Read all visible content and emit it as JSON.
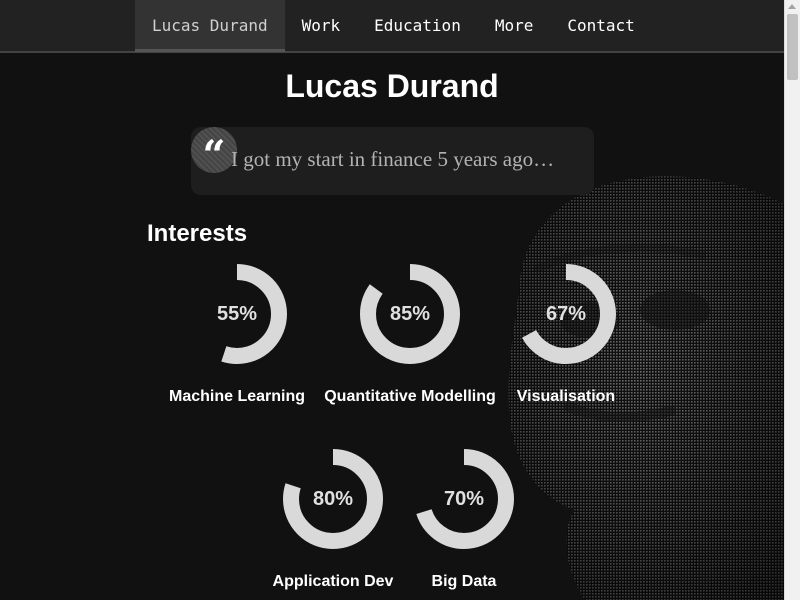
{
  "nav": {
    "items": [
      {
        "label": "Lucas Durand",
        "active": true
      },
      {
        "label": "Work",
        "active": false
      },
      {
        "label": "Education",
        "active": false
      },
      {
        "label": "More",
        "active": false
      },
      {
        "label": "Contact",
        "active": false
      }
    ]
  },
  "header": {
    "title": "Lucas Durand"
  },
  "quote": {
    "text": "I got my start in finance 5 years ago…",
    "icon": "quote-icon"
  },
  "interests": {
    "heading": "Interests",
    "ring_color": "#d9d9d9",
    "items": [
      {
        "label": "Machine Learning",
        "percent_text": "55%",
        "percent": 55
      },
      {
        "label": "Quantitative Modelling",
        "percent_text": "85%",
        "percent": 85
      },
      {
        "label": "Visualisation",
        "percent_text": "67%",
        "percent": 67
      },
      {
        "label": "Application Dev",
        "percent_text": "80%",
        "percent": 80
      },
      {
        "label": "Big Data",
        "percent_text": "70%",
        "percent": 70
      }
    ]
  },
  "colors": {
    "background": "#111111",
    "navbar": "#222222",
    "nav_active": "#333333",
    "quote_box": "#1e1e1e"
  }
}
